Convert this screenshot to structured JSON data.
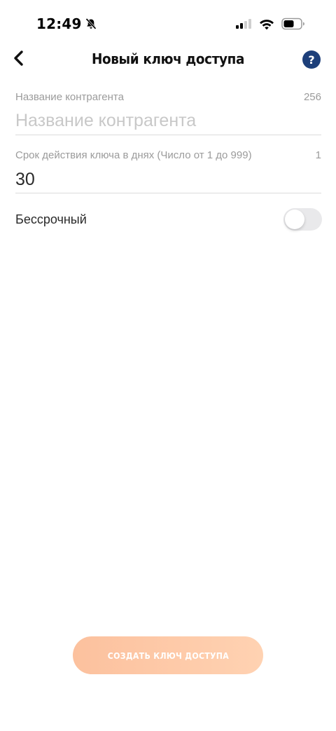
{
  "status_bar": {
    "time": "12:49",
    "icons": [
      "bell-slash-icon",
      "signal-icon",
      "wifi-icon",
      "battery-icon"
    ]
  },
  "nav": {
    "title": "Новый ключ доступа",
    "back_icon": "chevron-left-icon",
    "help_label": "?"
  },
  "form": {
    "name_field": {
      "label": "Название контрагента",
      "counter": "256",
      "value": "",
      "placeholder": "Название контрагента"
    },
    "term_field": {
      "label": "Срок действия ключа в днях (Число от 1 до 999)",
      "counter": "1",
      "value": "30",
      "placeholder": ""
    },
    "perpetual_toggle": {
      "label": "Бессрочный",
      "on": false
    }
  },
  "actions": {
    "create_label": "СОЗДАТЬ КЛЮЧ ДОСТУПА"
  },
  "colors": {
    "help_bg": "#1d3f7a",
    "button_gradient_start": "#fcc19e",
    "button_gradient_end": "#ffd2b2",
    "toggle_off_bg": "#e9e9eb",
    "label_gray": "#9b9b9b",
    "divider": "#dcdcdc"
  }
}
